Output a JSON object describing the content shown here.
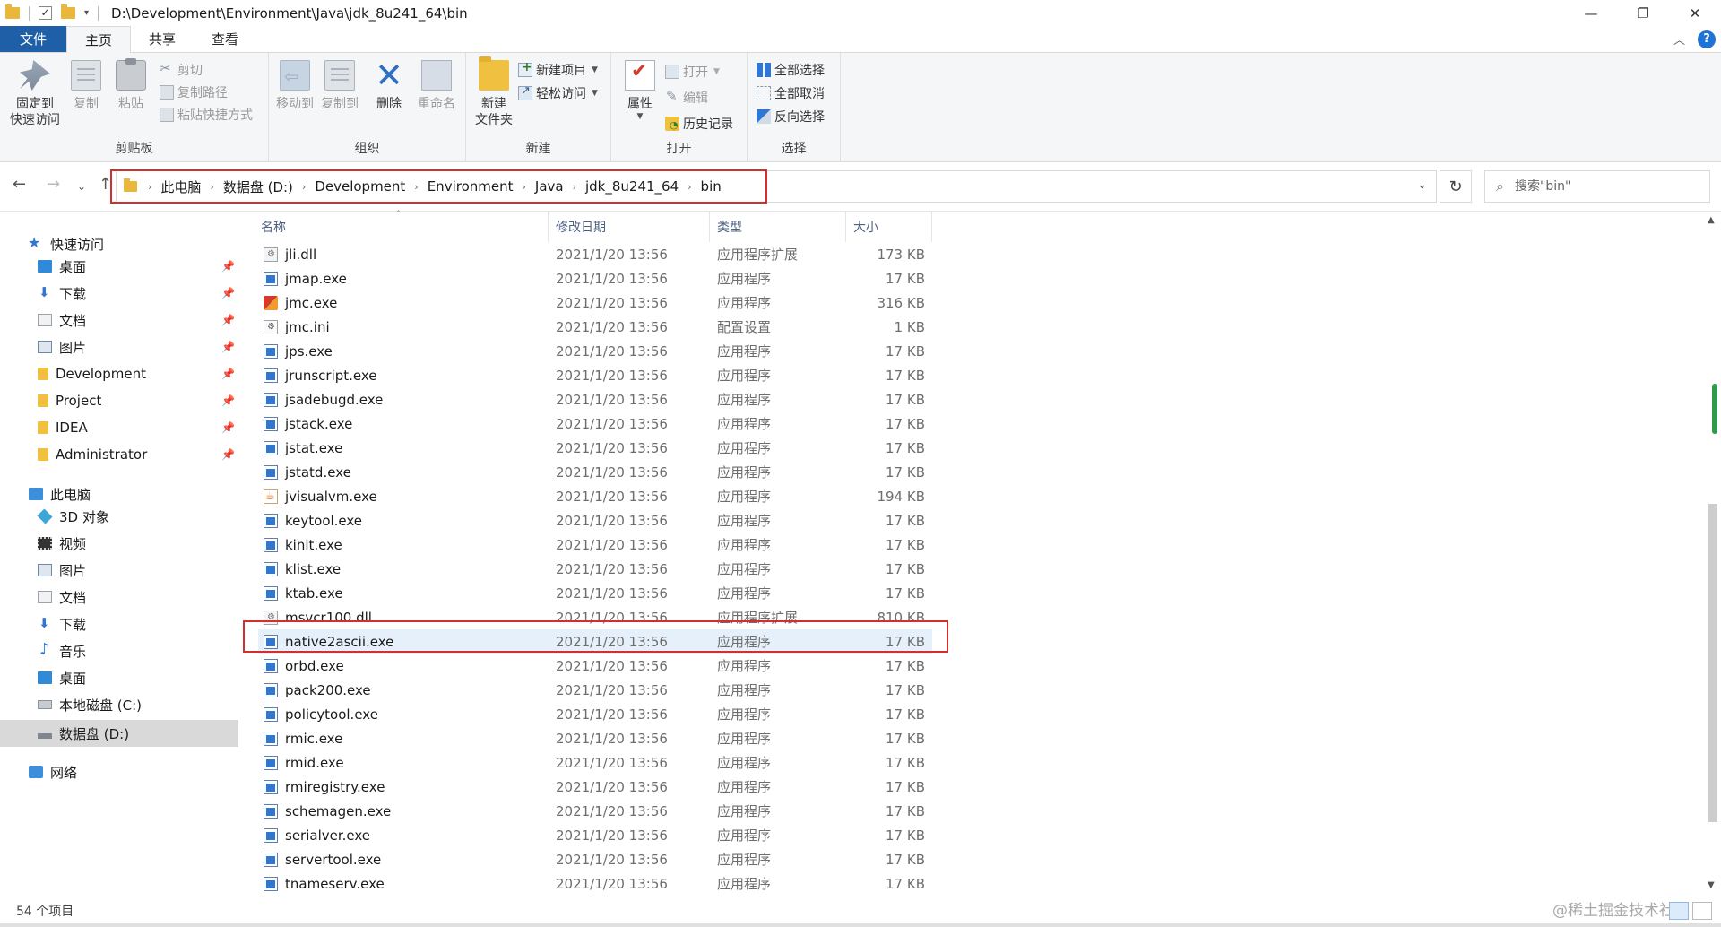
{
  "window": {
    "path_title": "D:\\Development\\Environment\\Java\\jdk_8u241_64\\bin",
    "minimize": "—",
    "restore": "❐",
    "close": "✕"
  },
  "tabs": {
    "file": "文件",
    "home": "主页",
    "share": "共享",
    "view": "查看",
    "help": "?"
  },
  "ribbon": {
    "clipboard": {
      "label": "剪贴板",
      "pin": "固定到\n快速访问",
      "copy": "复制",
      "paste": "粘贴",
      "cut": "剪切",
      "copy_path": "复制路径",
      "paste_shortcut": "粘贴快捷方式"
    },
    "organize": {
      "label": "组织",
      "move_to": "移动到",
      "copy_to": "复制到",
      "delete": "删除",
      "rename": "重命名"
    },
    "new": {
      "label": "新建",
      "new_folder": "新建\n文件夹",
      "new_item": "新建项目",
      "easy_access": "轻松访问"
    },
    "open": {
      "label": "打开",
      "properties": "属性",
      "open": "打开",
      "edit": "编辑",
      "history": "历史记录"
    },
    "select": {
      "label": "选择",
      "select_all": "全部选择",
      "select_none": "全部取消",
      "invert": "反向选择"
    }
  },
  "breadcrumb": [
    "此电脑",
    "数据盘 (D:)",
    "Development",
    "Environment",
    "Java",
    "jdk_8u241_64",
    "bin"
  ],
  "search": {
    "placeholder": "搜索\"bin\""
  },
  "nav": {
    "quick_access": "快速访问",
    "quick_items": [
      "桌面",
      "下载",
      "文档",
      "图片",
      "Development",
      "Project",
      "IDEA",
      "Administrator"
    ],
    "this_pc": "此电脑",
    "pc_items": [
      "3D 对象",
      "视频",
      "图片",
      "文档",
      "下载",
      "音乐",
      "桌面",
      "本地磁盘 (C:)",
      "数据盘 (D:)"
    ],
    "network": "网络"
  },
  "columns": {
    "name": "名称",
    "date": "修改日期",
    "type": "类型",
    "size": "大小"
  },
  "files": [
    {
      "name": "jli.dll",
      "date": "2021/1/20 13:56",
      "type": "应用程序扩展",
      "size": "173 KB",
      "icon": "dll"
    },
    {
      "name": "jmap.exe",
      "date": "2021/1/20 13:56",
      "type": "应用程序",
      "size": "17 KB",
      "icon": "exe"
    },
    {
      "name": "jmc.exe",
      "date": "2021/1/20 13:56",
      "type": "应用程序",
      "size": "316 KB",
      "icon": "jmc"
    },
    {
      "name": "jmc.ini",
      "date": "2021/1/20 13:56",
      "type": "配置设置",
      "size": "1 KB",
      "icon": "ini"
    },
    {
      "name": "jps.exe",
      "date": "2021/1/20 13:56",
      "type": "应用程序",
      "size": "17 KB",
      "icon": "exe"
    },
    {
      "name": "jrunscript.exe",
      "date": "2021/1/20 13:56",
      "type": "应用程序",
      "size": "17 KB",
      "icon": "exe"
    },
    {
      "name": "jsadebugd.exe",
      "date": "2021/1/20 13:56",
      "type": "应用程序",
      "size": "17 KB",
      "icon": "exe"
    },
    {
      "name": "jstack.exe",
      "date": "2021/1/20 13:56",
      "type": "应用程序",
      "size": "17 KB",
      "icon": "exe"
    },
    {
      "name": "jstat.exe",
      "date": "2021/1/20 13:56",
      "type": "应用程序",
      "size": "17 KB",
      "icon": "exe"
    },
    {
      "name": "jstatd.exe",
      "date": "2021/1/20 13:56",
      "type": "应用程序",
      "size": "17 KB",
      "icon": "exe"
    },
    {
      "name": "jvisualvm.exe",
      "date": "2021/1/20 13:56",
      "type": "应用程序",
      "size": "194 KB",
      "icon": "jvisual"
    },
    {
      "name": "keytool.exe",
      "date": "2021/1/20 13:56",
      "type": "应用程序",
      "size": "17 KB",
      "icon": "exe"
    },
    {
      "name": "kinit.exe",
      "date": "2021/1/20 13:56",
      "type": "应用程序",
      "size": "17 KB",
      "icon": "exe"
    },
    {
      "name": "klist.exe",
      "date": "2021/1/20 13:56",
      "type": "应用程序",
      "size": "17 KB",
      "icon": "exe"
    },
    {
      "name": "ktab.exe",
      "date": "2021/1/20 13:56",
      "type": "应用程序",
      "size": "17 KB",
      "icon": "exe"
    },
    {
      "name": "msvcr100.dll",
      "date": "2021/1/20 13:56",
      "type": "应用程序扩展",
      "size": "810 KB",
      "icon": "dll"
    },
    {
      "name": "native2ascii.exe",
      "date": "2021/1/20 13:56",
      "type": "应用程序",
      "size": "17 KB",
      "icon": "exe",
      "selected": true
    },
    {
      "name": "orbd.exe",
      "date": "2021/1/20 13:56",
      "type": "应用程序",
      "size": "17 KB",
      "icon": "exe"
    },
    {
      "name": "pack200.exe",
      "date": "2021/1/20 13:56",
      "type": "应用程序",
      "size": "17 KB",
      "icon": "exe"
    },
    {
      "name": "policytool.exe",
      "date": "2021/1/20 13:56",
      "type": "应用程序",
      "size": "17 KB",
      "icon": "exe"
    },
    {
      "name": "rmic.exe",
      "date": "2021/1/20 13:56",
      "type": "应用程序",
      "size": "17 KB",
      "icon": "exe"
    },
    {
      "name": "rmid.exe",
      "date": "2021/1/20 13:56",
      "type": "应用程序",
      "size": "17 KB",
      "icon": "exe"
    },
    {
      "name": "rmiregistry.exe",
      "date": "2021/1/20 13:56",
      "type": "应用程序",
      "size": "17 KB",
      "icon": "exe"
    },
    {
      "name": "schemagen.exe",
      "date": "2021/1/20 13:56",
      "type": "应用程序",
      "size": "17 KB",
      "icon": "exe"
    },
    {
      "name": "serialver.exe",
      "date": "2021/1/20 13:56",
      "type": "应用程序",
      "size": "17 KB",
      "icon": "exe"
    },
    {
      "name": "servertool.exe",
      "date": "2021/1/20 13:56",
      "type": "应用程序",
      "size": "17 KB",
      "icon": "exe"
    },
    {
      "name": "tnameserv.exe",
      "date": "2021/1/20 13:56",
      "type": "应用程序",
      "size": "17 KB",
      "icon": "exe"
    }
  ],
  "status": {
    "item_count": "54 个项目",
    "watermark": "@稀土掘金技术社区"
  },
  "colors": {
    "file_tab": "#1f5fa8",
    "highlight_box": "#d32f2f",
    "selected_row": "#e5f0fb",
    "selected_nav": "#d9d9d9"
  }
}
